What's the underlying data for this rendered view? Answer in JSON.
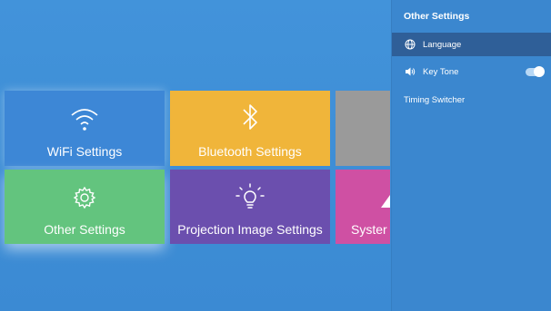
{
  "tiles": {
    "wifi": {
      "label": "WiFi Settings",
      "icon": "wifi-icon"
    },
    "bluetooth": {
      "label": "Bluetooth Settings",
      "icon": "bluetooth-icon"
    },
    "other": {
      "label": "Other Settings",
      "icon": "gear-icon"
    },
    "projection": {
      "label": "Projection Image Settings",
      "icon": "lightbulb-icon"
    },
    "system": {
      "label": "Syster"
    }
  },
  "panel": {
    "title": "Other Settings",
    "items": [
      {
        "label": "Language",
        "icon": "globe-icon",
        "selected": true
      },
      {
        "label": "Key Tone",
        "icon": "speaker-icon",
        "toggle": true
      },
      {
        "label": "Timing Switcher"
      }
    ]
  },
  "colors": {
    "background": "#3f8fd6",
    "wifi": "#3d87d6",
    "bluetooth": "#f0b53a",
    "other": "#63c47e",
    "projection": "#6b4fae",
    "system": "#cf50a3",
    "selected_item": "#2f5f98"
  }
}
